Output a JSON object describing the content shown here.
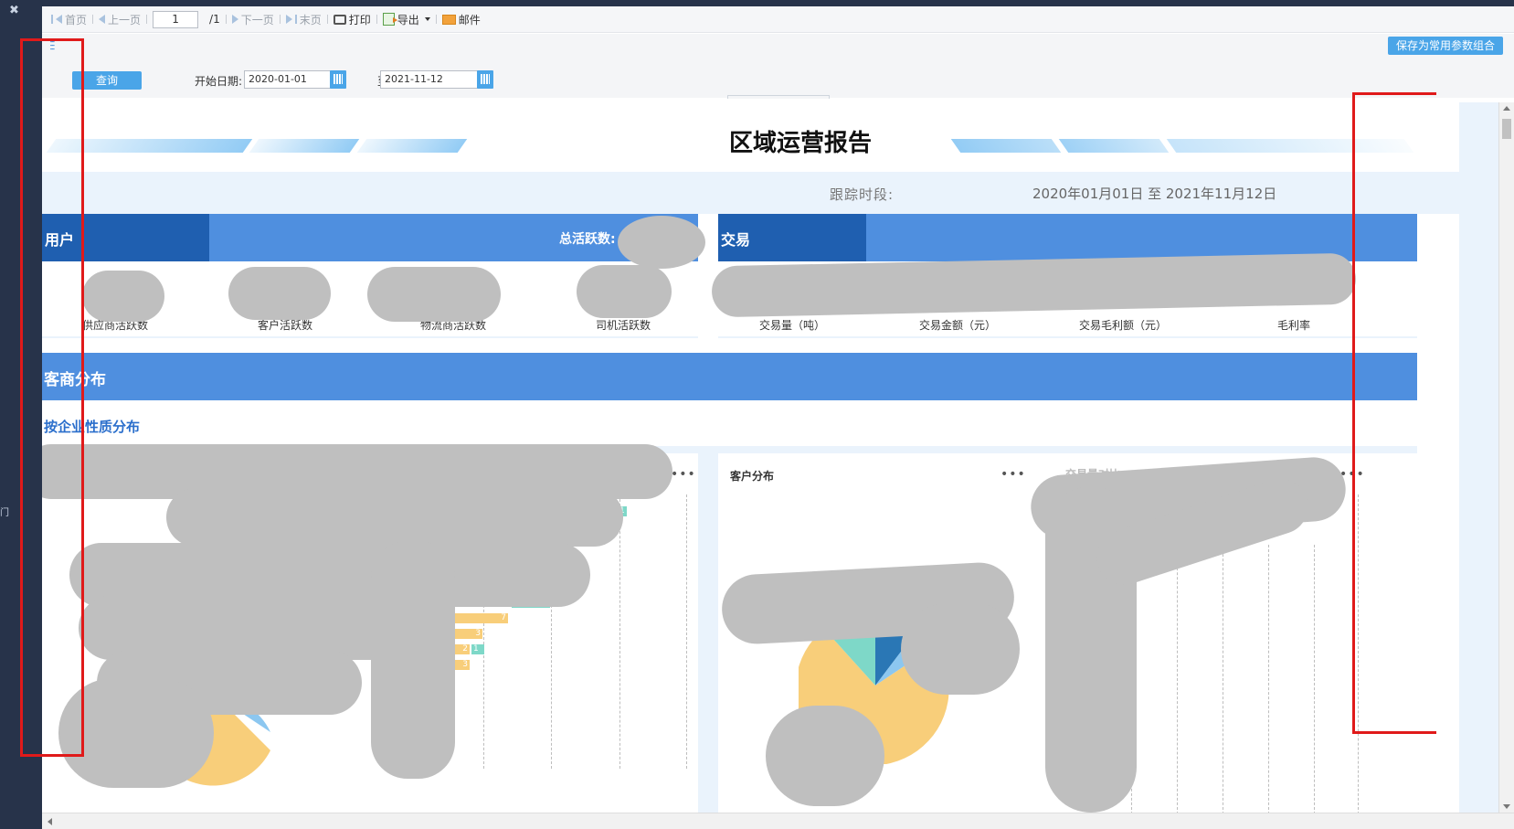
{
  "toolbar": {
    "first": "首页",
    "prev": "上一页",
    "page_value": "1",
    "page_total": "/1",
    "next": "下一页",
    "last": "末页",
    "print": "打印",
    "export": "导出",
    "mail": "邮件"
  },
  "params": {
    "save_combo": "保存为常用参数组合",
    "query": "查询",
    "start_label": "开始日期:",
    "start_value": "2020-01-01",
    "to_label": "至",
    "end_value": "2021-11-12"
  },
  "report": {
    "title": "区域运营报告",
    "track_label": "跟踪时段:",
    "track_value": "2020年01月01日  至  2021年11月12日",
    "users": {
      "title": "用户",
      "total_label": "总活跃数:",
      "metrics": [
        "供应商活跃数",
        "客户活跃数",
        "物流商活跃数",
        "司机活跃数"
      ]
    },
    "trade": {
      "title": "交易",
      "metrics": [
        "交易量（吨）",
        "交易金额（元）",
        "交易毛利额（元）",
        "毛利率"
      ]
    },
    "section": "客商分布",
    "subsection": "按企业性质分布",
    "panel_customer": "客户分布",
    "panel_third": "交易量对比",
    "bar_labels": [
      "1",
      "3",
      "7",
      "3",
      "2",
      "1",
      "3"
    ]
  },
  "left_nav": {
    "edge_char": "门"
  },
  "colors": {
    "header_blue": "#4f8fdf",
    "header_dark_blue": "#1f5fb0",
    "button_blue": "#4aa5e8",
    "pie_yellow": "#f8ce7a",
    "pie_teal": "#7ed8c8",
    "pie_blue": "#2a77b5",
    "pie_light_blue": "#8cc7f0"
  }
}
